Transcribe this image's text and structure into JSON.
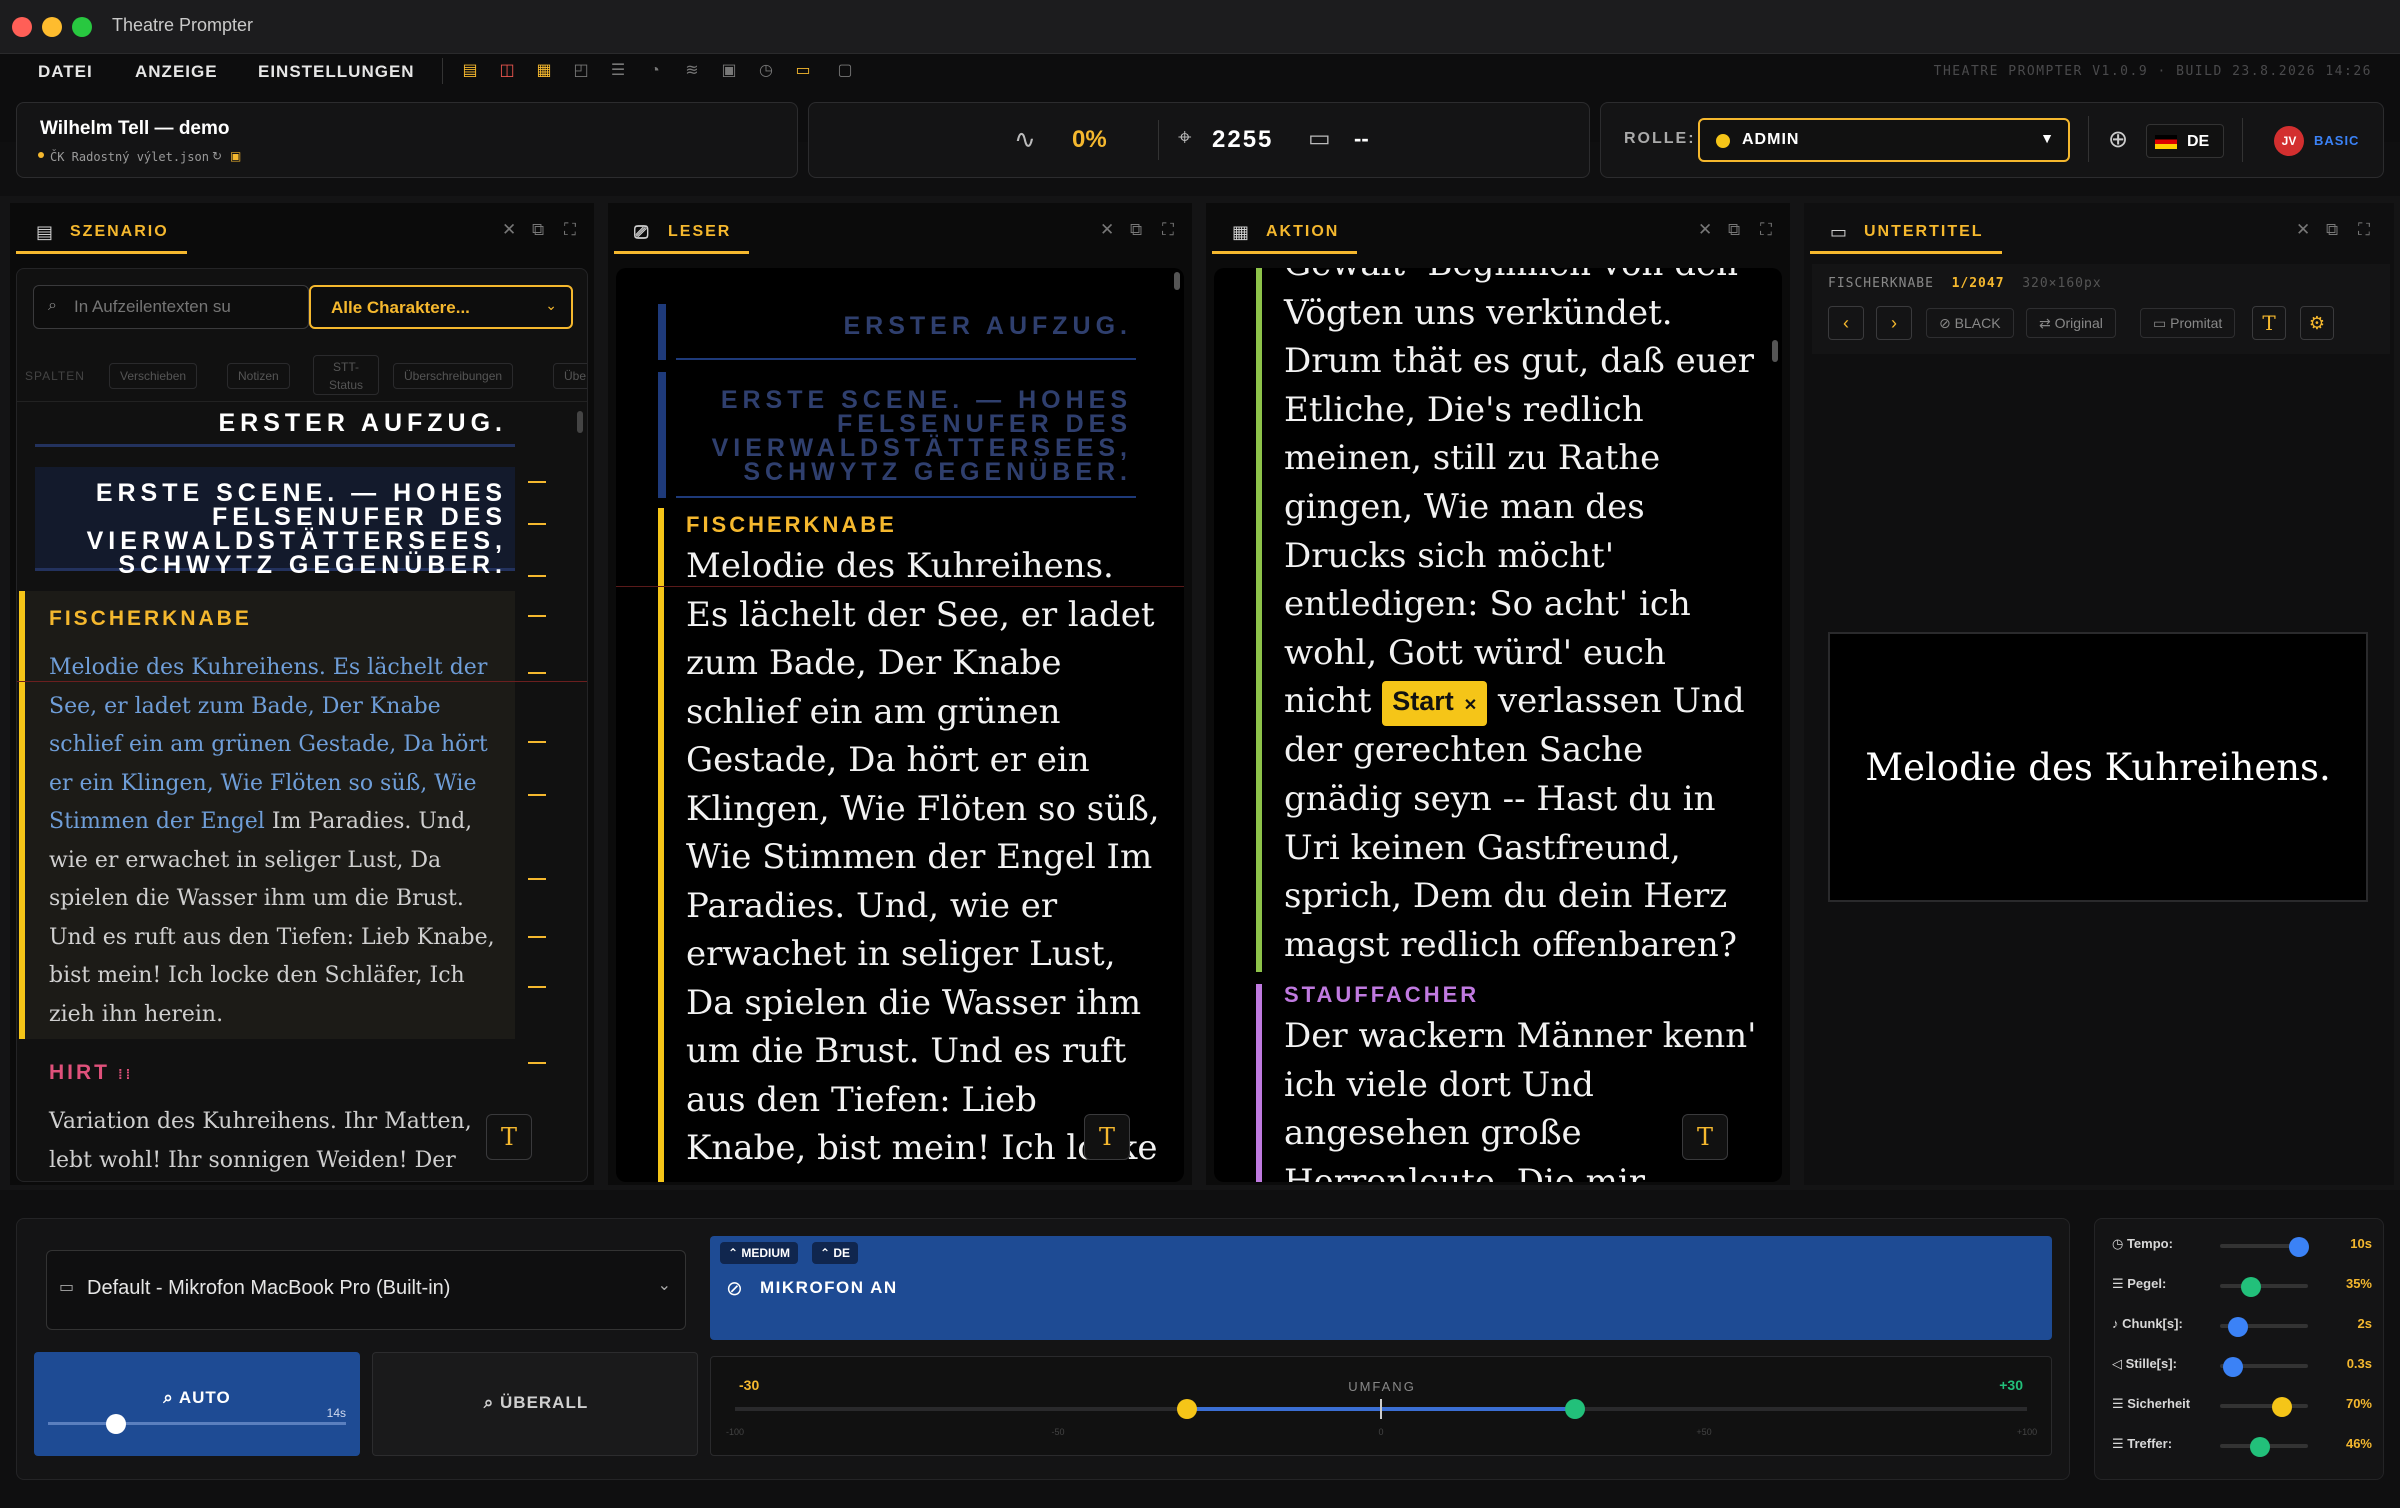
{
  "window": {
    "title": "Theatre Prompter"
  },
  "menu": {
    "items": [
      "DATEI",
      "ANZEIGE",
      "EINSTELLUNGEN"
    ],
    "build": "THEATRE PROMPTER V1.0.9 · BUILD 23.8.2026 14:26"
  },
  "project": {
    "title": "Wilhelm Tell — demo",
    "file": "ČK Radostný výlet.json"
  },
  "stats": {
    "percent": "0%",
    "position": "2255",
    "comment": "--"
  },
  "role": {
    "label": "ROLLE:",
    "value": "ADMIN"
  },
  "lang": {
    "value": "DE"
  },
  "user": {
    "initials": "JV",
    "plan": "BASIC"
  },
  "panels": {
    "szenario": {
      "title": "SZENARIO"
    },
    "leser": {
      "title": "LESER"
    },
    "aktion": {
      "title": "AKTION"
    },
    "untertitel": {
      "title": "UNTERTITEL"
    }
  },
  "szenario": {
    "search_placeholder": "In Aufzeilentexten su",
    "character_filter": "Alle Charaktere...",
    "columns_label": "SPALTEN",
    "columns": [
      "Verschieben",
      "Notizen",
      "STT-Status",
      "Überschreibungen",
      "Übe"
    ],
    "heading1": "ERSTER AUFZUG.",
    "heading2": "ERSTE SCENE. — HOHES FELSENUFER DES VIERWALDSTÄTTERSEES, SCHWYTZ GEGENÜBER.",
    "role1": "FISCHERKNABE",
    "text1_highlighted": "Melodie des Kuhreihens. Es lächelt der See, er ladet zum Bade, Der Knabe schlief ein am grünen Gestade, Da hört er ein Klingen, Wie Flöten so süß, Wie Stimmen der Engel",
    "text1_rest": " Im Paradies. Und, wie er erwachet in seliger Lust, Da spielen die Wasser ihm um die Brust. Und es ruft aus den Tiefen: Lieb Knabe, bist mein! Ich locke den Schläfer, Ich zieh ihn herein.",
    "role2": "HIRT",
    "text2": "Variation des Kuhreihens. Ihr Matten, lebt wohl! Ihr sonnigen Weiden! Der"
  },
  "leser": {
    "heading1": "ERSTER AUFZUG.",
    "heading2": "ERSTE SCENE. — HOHES FELSENUFER DES VIERWALDSTÄTTERSEES, SCHWYTZ GEGENÜBER.",
    "role": "FISCHERKNABE",
    "text": "Melodie des Kuhreihens. Es lächelt der See, er ladet zum Bade, Der Knabe schlief ein am grünen Gestade, Da hört er ein Klingen, Wie Flöten so süß, Wie Stimmen der Engel Im Paradies. Und, wie er erwachet in seliger Lust, Da spielen die Wasser ihm um die Brust. Und es ruft aus den Tiefen: Lieb Knabe, bist mein! Ich locke den Schläfer, Ich zieh"
  },
  "aktion": {
    "text_before": "Gewalt- Beginnen von den Vögten uns verkündet. Drum thät es gut, daß euer Etliche, Die's redlich meinen, still zu Rathe gingen, Wie man des Drucks sich möcht' entledigen: So acht' ich wohl, Gott würd' euch nicht",
    "start_label": "Start",
    "text_after": "verlassen Und der gerechten Sache gnädig seyn -- Hast du in Uri keinen Gastfreund, sprich, Dem du dein Herz magst redlich offenbaren?",
    "role": "STAUFFACHER",
    "text2": "Der wackern Männer kenn' ich viele dort Und angesehen große Herrenleute, Die mir"
  },
  "untertitel": {
    "speaker": "FISCHERKNABE",
    "counter": "1/2047",
    "resolution": "320×160px",
    "buttons": [
      "BLACK",
      "Original",
      "Promitat"
    ],
    "subtitle": "Melodie des Kuhreihens."
  },
  "bottom": {
    "mic_device": "Default - Mikrofon MacBook Pro (Built-in)",
    "badges": [
      "MEDIUM",
      "DE"
    ],
    "mic_status": "MIKROFON AN",
    "auto_label": "AUTO",
    "auto_value": "14s",
    "overall_label": "ÜBERALL",
    "range": {
      "title": "UMFANG",
      "min_label": "-30",
      "max_label": "+30",
      "ticks": [
        "-100",
        "-50",
        "0",
        "+50",
        "+100"
      ],
      "low": -30,
      "high": 30
    },
    "sliders": [
      {
        "label": "Tempo:",
        "value": "10s",
        "fraction": 0.9,
        "color": "#3b82f6"
      },
      {
        "label": "Pegel:",
        "value": "35%",
        "fraction": 0.35,
        "color": "#22c07a"
      },
      {
        "label": "Chunk[s]:",
        "value": "2s",
        "fraction": 0.2,
        "color": "#3b82f6"
      },
      {
        "label": "Stille[s]:",
        "value": "0.3s",
        "fraction": 0.15,
        "color": "#3b82f6"
      },
      {
        "label": "Sicherheit",
        "value": "70%",
        "fraction": 0.7,
        "color": "#f5c518"
      },
      {
        "label": "Treffer:",
        "value": "46%",
        "fraction": 0.46,
        "color": "#22c07a"
      }
    ]
  }
}
